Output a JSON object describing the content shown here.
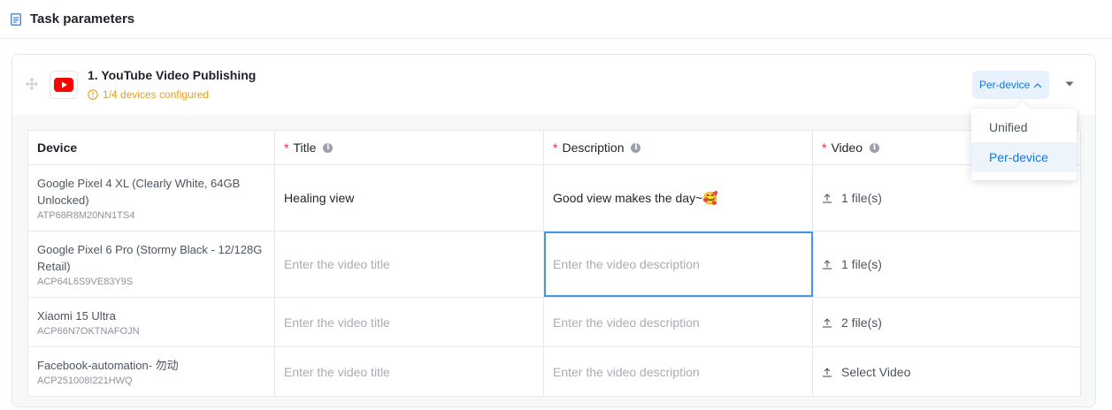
{
  "header": {
    "title": "Task parameters",
    "icon": "document-icon"
  },
  "task": {
    "name": "1. YouTube Video Publishing",
    "status": "1/4 devices configured",
    "status_color": "#e8a01b",
    "mode_label": "Per-device"
  },
  "table": {
    "columns": {
      "device": "Device",
      "title": "Title",
      "description": "Description",
      "video": "Video",
      "required_mark": "*"
    },
    "rows": [
      {
        "device_name": "Google Pixel 4 XL (Clearly White, 64GB Unlocked)",
        "serial": "ATP68R8M20NN1TS4",
        "title": "Healing view",
        "description": "Good view makes the day~🥰",
        "video": "1 file(s)"
      },
      {
        "device_name": "Google Pixel 6 Pro (Stormy Black - 12/128G Retail)",
        "serial": "ACP64L6S9VE83Y9S",
        "title": "",
        "description": "",
        "video": "1 file(s)"
      },
      {
        "device_name": "Xiaomi 15 Ultra",
        "serial": "ACP66N7OKTNAFOJN",
        "title": "",
        "description": "",
        "video": "2 file(s)"
      },
      {
        "device_name": "Facebook-automation- 勿动",
        "serial": "ACP251008I221HWQ",
        "title": "",
        "description": "",
        "video": "Select Video"
      }
    ],
    "title_placeholder": "Enter the video title",
    "description_placeholder": "Enter the video description"
  },
  "dropdown": {
    "options": [
      "Unified",
      "Per-device"
    ],
    "selected": "Per-device"
  },
  "colors": {
    "accent": "#1677d9",
    "required": "#f5313d",
    "youtube": "#ff0000"
  }
}
